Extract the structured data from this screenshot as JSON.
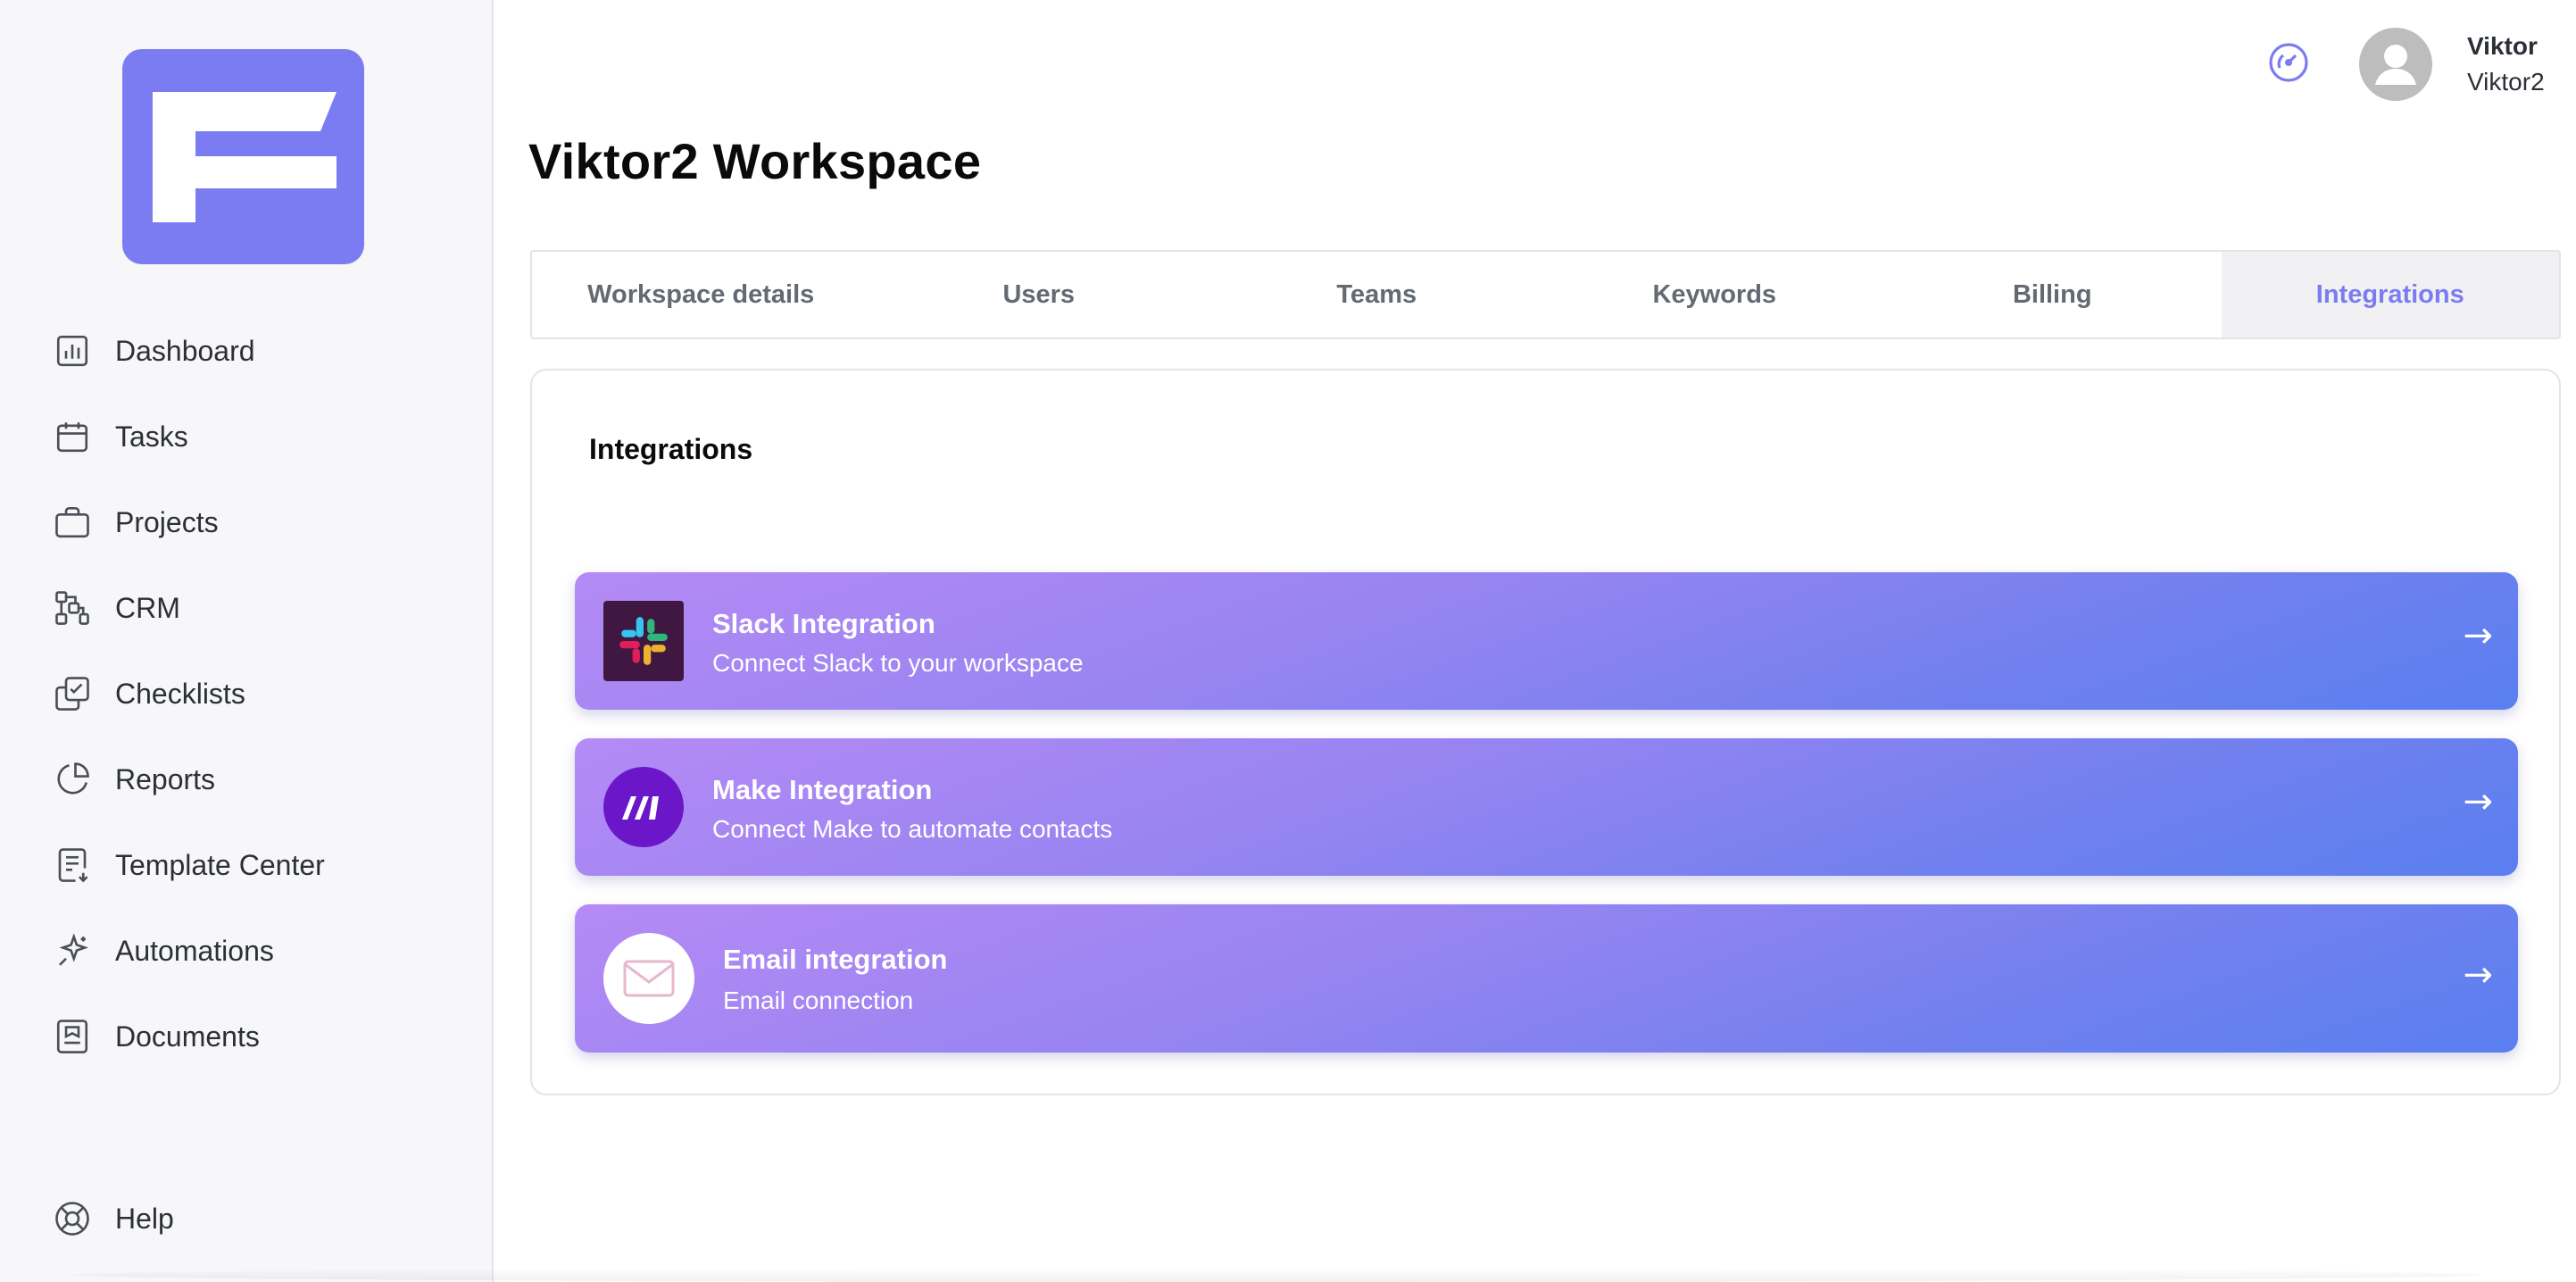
{
  "sidebar": {
    "items": [
      {
        "label": "Dashboard",
        "icon": "chart-icon"
      },
      {
        "label": "Tasks",
        "icon": "calendar-icon"
      },
      {
        "label": "Projects",
        "icon": "briefcase-icon"
      },
      {
        "label": "CRM",
        "icon": "crm-icon"
      },
      {
        "label": "Checklists",
        "icon": "checklist-icon"
      },
      {
        "label": "Reports",
        "icon": "pie-chart-icon"
      },
      {
        "label": "Template Center",
        "icon": "template-icon"
      },
      {
        "label": "Automations",
        "icon": "sparkle-icon"
      },
      {
        "label": "Documents",
        "icon": "document-icon"
      }
    ],
    "help": {
      "label": "Help",
      "icon": "lifebuoy-icon"
    }
  },
  "header": {
    "user_name": "Viktor",
    "workspace_name": "Viktor2"
  },
  "page": {
    "title": "Viktor2 Workspace"
  },
  "tabs": [
    {
      "label": "Workspace details",
      "active": false
    },
    {
      "label": "Users",
      "active": false
    },
    {
      "label": "Teams",
      "active": false
    },
    {
      "label": "Keywords",
      "active": false
    },
    {
      "label": "Billing",
      "active": false
    },
    {
      "label": "Integrations",
      "active": true
    }
  ],
  "panel": {
    "title": "Integrations",
    "integrations": [
      {
        "title": "Slack Integration",
        "subtitle": "Connect Slack to your workspace",
        "icon": "slack-icon",
        "arrow": "→"
      },
      {
        "title": "Make Integration",
        "subtitle": "Connect Make to automate contacts",
        "icon": "make-icon",
        "arrow": "→"
      },
      {
        "title": "Email integration",
        "subtitle": "Email connection",
        "icon": "email-icon",
        "arrow": "→"
      }
    ]
  },
  "colors": {
    "accent": "#7c7cf2",
    "sidebar_bg": "#f7f7f9",
    "card_gradient_start": "#b58af5",
    "card_gradient_end": "#5a7ff0"
  }
}
